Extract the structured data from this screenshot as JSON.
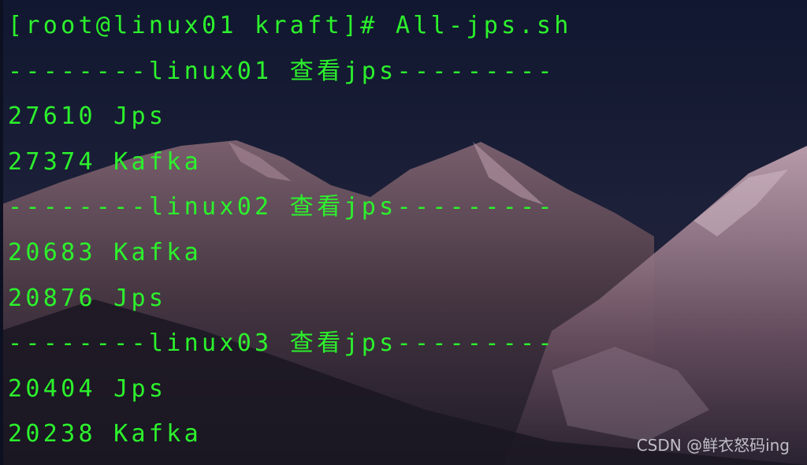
{
  "terminal": {
    "lines": [
      "[root@linux01 kraft]# All-jps.sh",
      "--------linux01 查看jps---------",
      "27610 Jps",
      "27374 Kafka",
      "--------linux02 查看jps---------",
      "20683 Kafka",
      "20876 Jps",
      "--------linux03 查看jps---------",
      "20404 Jps",
      "20238 Kafka"
    ],
    "text_color": "#2cf22c"
  },
  "watermark": "CSDN @鲜衣怒码ing",
  "colors": {
    "sky_top": "#141a33",
    "sky_bottom": "#2a2540",
    "mountain": "#5a4450",
    "snow": "#c9b8c4"
  }
}
